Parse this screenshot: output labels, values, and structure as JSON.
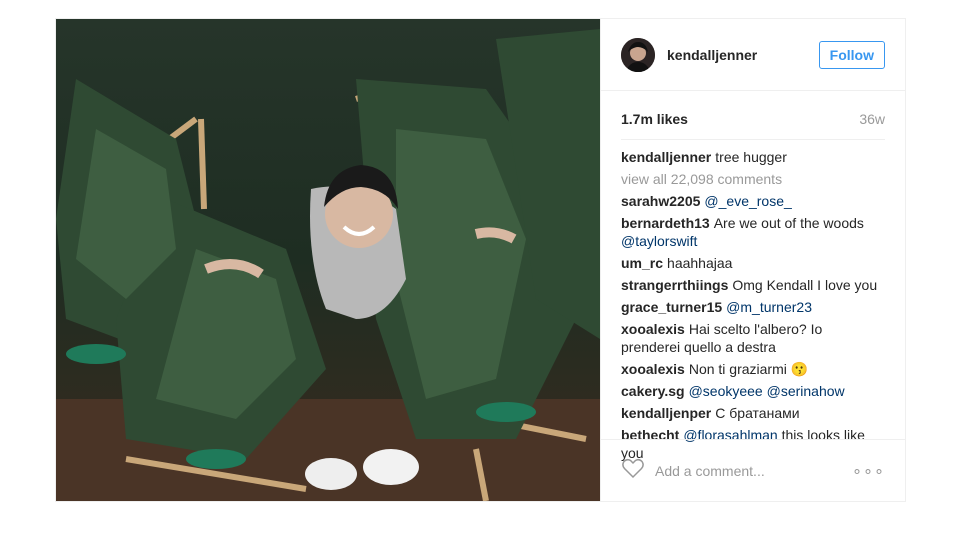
{
  "post": {
    "username": "kendalljenner",
    "follow_label": "Follow",
    "likes": "1.7m likes",
    "age": "36w",
    "caption": {
      "user": "kendalljenner",
      "text": "tree hugger"
    },
    "view_all": "view all 22,098 comments",
    "comments": [
      {
        "user": "sarahw2205",
        "text": "",
        "mention": "@_eve_rose_"
      },
      {
        "user": "bernardeth13",
        "text": "Are we out of the woods",
        "mention": "@taylorswift"
      },
      {
        "user": "um_rc",
        "text": "haahhajaa",
        "mention": ""
      },
      {
        "user": "strangerrthiings",
        "text": "Omg Kendall I love you",
        "mention": ""
      },
      {
        "user": "grace_turner15",
        "text": "",
        "mention": "@m_turner23"
      },
      {
        "user": "xooalexis",
        "text": "Hai scelto l'albero? Io prenderei quello a destra",
        "mention": ""
      },
      {
        "user": "xooalexis",
        "text": "Non ti graziarmi 😗",
        "mention": ""
      },
      {
        "user": "cakery.sg",
        "text": "",
        "mention": "@seokyeee @serinahow"
      },
      {
        "user": "kendalljenper",
        "text": "С братанами",
        "mention": ""
      },
      {
        "user": "bethecht",
        "text": "",
        "mention": "@florasahlman",
        "text_after": "this looks like you"
      }
    ],
    "add_comment_placeholder": "Add a comment...",
    "more_glyph": "∘∘∘"
  },
  "colors": {
    "accent": "#3897f0",
    "muted": "#999999",
    "mention": "#003569"
  }
}
